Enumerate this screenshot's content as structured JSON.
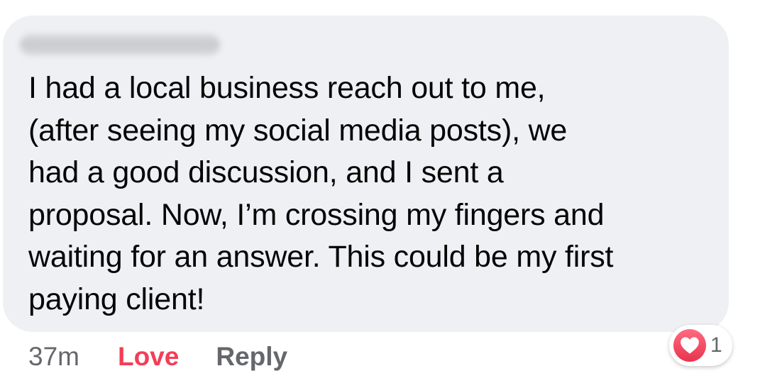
{
  "comment": {
    "text": "I had a local business reach out to me,\n(after seeing my social media posts), we\nhad a good discussion, and I sent a\nproposal. Now, I’m crossing my fingers and\nwaiting for an answer. This could be my first\npaying client!"
  },
  "actions": {
    "timestamp": "37m",
    "love_label": "Love",
    "reply_label": "Reply"
  },
  "reactions": {
    "icon": "heart-icon",
    "count": "1",
    "color": "#f33e58"
  }
}
